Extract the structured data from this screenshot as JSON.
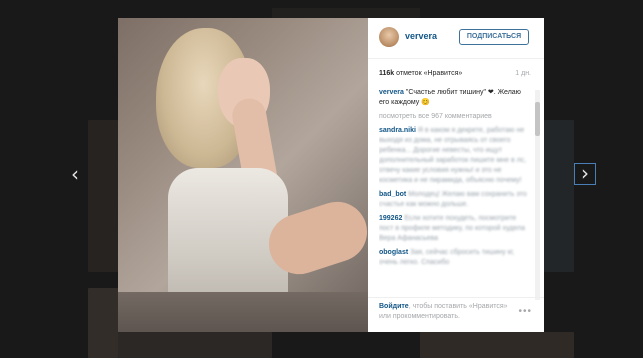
{
  "post": {
    "username": "ververa",
    "follow_label": "ПОДПИСАТЬСЯ",
    "likes_count": "116k",
    "likes_label": "отметок «Нравится»",
    "time_ago": "1 дн.",
    "caption_user": "ververa",
    "caption_text": "\"Счастье любит тишину\" ❤. Желаю его каждому 😊",
    "view_all_comments": "посмотреть все 967 комментариев",
    "comments": [
      {
        "user": "sandra.niki",
        "text": "Я в каком я декрете, работаю не выходя из дома, не отрываясь от своего ребенка... Дорогие невесты, что ищут дополнительный заработок пишите мне в лс, отвечу какие условия нужны! и это не косметика и не пирамида, объясню почему!"
      },
      {
        "user": "bad_bot",
        "text": "Молодец! Желаю вам сохранить это счастье как можно дольше."
      },
      {
        "user": "199262",
        "text": "Если хотите похудеть, посмотрите пост в профиле методику, по которой худела Вера Афанасьева"
      },
      {
        "user": "oboglast",
        "text": "Зая, сейчас сбросить тишину кг, очень легко. Спасибо"
      }
    ],
    "login_link": "Войдите",
    "login_text": ", чтобы поставить «Нравится» или прокомментировать.",
    "more_icon": "•••"
  },
  "nav": {
    "prev": "‹",
    "next": "›"
  }
}
